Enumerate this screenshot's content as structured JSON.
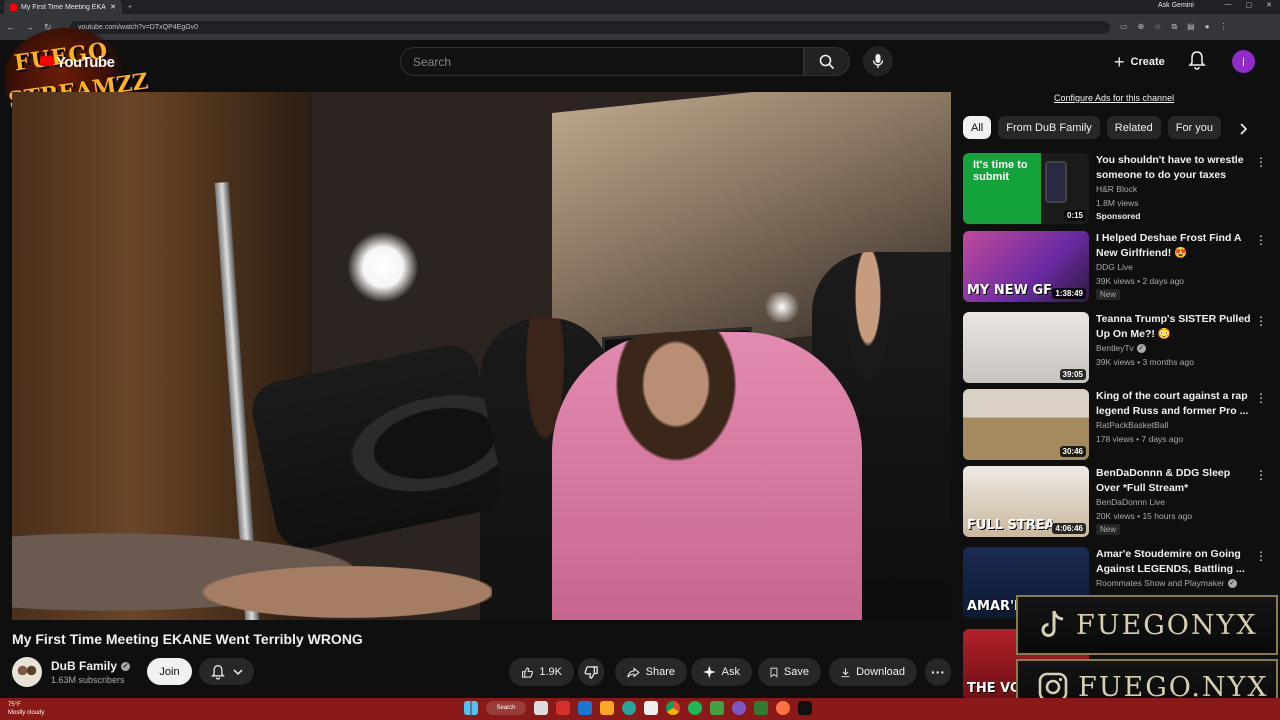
{
  "browser": {
    "tab_title": "My First Time Meeting EKANE",
    "url": "youtube.com/watch?v=DTxQP4EgGv0",
    "gemini": "Ask Gemini"
  },
  "header": {
    "logo_line1": "FUEGO",
    "logo_line2": "STREAMZZ",
    "youtube_word": "YouTube",
    "search_placeholder": "Search",
    "create_label": "Create",
    "avatar_letter": "i"
  },
  "video": {
    "title": "My First Time Meeting EKANE Went Terribly WRONG",
    "channel_name": "DuB Family",
    "subscribers": "1.63M subscribers",
    "join_label": "Join",
    "likes": "1.9K",
    "share_label": "Share",
    "ask_label": "Ask",
    "save_label": "Save",
    "download_label": "Download"
  },
  "sidebar": {
    "config_ads": "Configure Ads for this channel",
    "chips": [
      "All",
      "From DuB Family",
      "Related",
      "For you"
    ],
    "recommendations": [
      {
        "title": "You shouldn't have to wrestle someone to do your taxes",
        "channel": "H&R Block",
        "meta": "1.8M views",
        "badge": "Sponsored",
        "duration": "0:15",
        "thumb_text": "It's time to submit",
        "verified": false
      },
      {
        "title": "I Helped Deshae Frost Find A New Girlfriend! 😍",
        "channel": "DDG Live",
        "meta": "39K views • 2 days ago",
        "badge": "New",
        "duration": "1:38:49",
        "thumb_text": "MY NEW GF",
        "verified": false
      },
      {
        "title": "Teanna Trump's SISTER Pulled Up On Me?! 😳",
        "channel": "BentleyTv",
        "meta": "39K views • 3 months ago",
        "badge": "",
        "duration": "39:05",
        "thumb_text": "",
        "verified": true
      },
      {
        "title": "King of the court against a rap legend Russ and former Pro ...",
        "channel": "RatPackBasketBall",
        "meta": "178 views • 7 days ago",
        "badge": "",
        "duration": "30:46",
        "thumb_text": "",
        "verified": false
      },
      {
        "title": "BenDaDonnn & DDG Sleep Over *Full Stream*",
        "channel": "BenDaDonnn Live",
        "meta": "20K views • 15 hours ago",
        "badge": "New",
        "duration": "4:06:46",
        "thumb_text": "FULL STREA",
        "verified": false
      },
      {
        "title": "Amar'e Stoudemire on Going Against LEGENDS, Battling ...",
        "channel": "Roommates Show and Playmaker",
        "meta": "",
        "badge": "",
        "duration": "",
        "thumb_text": "AMAR'E S",
        "verified": true
      },
      {
        "title": "",
        "channel": "",
        "meta": "",
        "badge": "",
        "duration": "",
        "thumb_text": "THE VOIC",
        "verified": false
      }
    ]
  },
  "overlay": {
    "tiktok": "FUEGONYX",
    "instagram": "FUEGO.NYX"
  },
  "taskbar": {
    "temp": "75°F",
    "weather": "Mostly cloudy",
    "search": "Search"
  },
  "colors": {
    "brand": "#ff0000",
    "accent": "#8e2bc9",
    "taskbar": "#8a1a1a"
  }
}
